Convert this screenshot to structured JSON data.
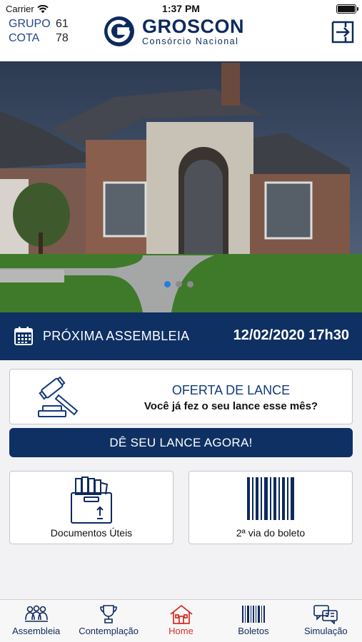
{
  "status_bar": {
    "carrier": "Carrier",
    "time": "1:37 PM"
  },
  "header": {
    "group_label": "GRUPO",
    "group_value": "61",
    "quota_label": "COTA",
    "quota_value": "78",
    "brand_name": "GROSCON",
    "brand_subtitle": "Consórcio Nacional",
    "exit_icon": "logout-icon"
  },
  "carousel": {
    "slides": 3,
    "active_index": 0
  },
  "assembly": {
    "label": "PRÓXIMA ASSEMBLEIA",
    "date": "12/02/2020 17h30",
    "icon": "calendar-icon"
  },
  "offer": {
    "title": "OFERTA DE LANCE",
    "subtitle": "Você já fez o seu lance esse mês?",
    "icon": "gavel-icon"
  },
  "cta": {
    "label": "DÊ SEU LANCE AGORA!"
  },
  "tiles": [
    {
      "label": "Documentos Úteis",
      "icon": "documents-box-icon"
    },
    {
      "label": "2ª via do boleto",
      "icon": "barcode-icon"
    }
  ],
  "tabs": [
    {
      "label": "Assembleia",
      "icon": "people-icon"
    },
    {
      "label": "Contemplação",
      "icon": "trophy-icon"
    },
    {
      "label": "Home",
      "icon": "house-icon",
      "active": true
    },
    {
      "label": "Boletos",
      "icon": "barcode-icon"
    },
    {
      "label": "Simulação",
      "icon": "chat-calculator-icon"
    }
  ],
  "colors": {
    "primary": "#0e3063",
    "active_tab": "#d9322a",
    "dot_active": "#2a7be0"
  }
}
